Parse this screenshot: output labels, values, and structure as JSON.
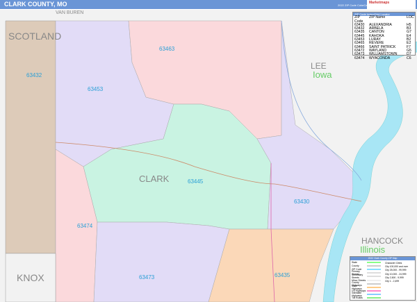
{
  "header": {
    "title": "CLARK COUNTY, MO",
    "edition": "2022 ZIP Code ColorCast Edition",
    "logo": "Marketmaps"
  },
  "map": {
    "neighbors": [
      {
        "name": "SCOTLAND"
      },
      {
        "name": "KNOX"
      },
      {
        "name": "VAN BUREN"
      },
      {
        "name": "LEE"
      },
      {
        "name": "HANCOCK"
      }
    ],
    "states": [
      {
        "name": "Iowa"
      },
      {
        "name": "Illinois"
      }
    ],
    "county": "CLARK",
    "zips": [
      "63463",
      "63453",
      "63432",
      "63445",
      "63430",
      "63474",
      "63473",
      "63435"
    ],
    "colors": {
      "pink": "#fbd9dc",
      "purple": "#e2dcf7",
      "green": "#c9f3e2",
      "orange": "#fbd8b8",
      "tan": "#ddcbb9",
      "river": "#a8e6f5",
      "gray": "#f2f2f2",
      "accent": "#6a95d6"
    }
  },
  "zip_table": {
    "title": "ZIP Code Index/Grid Locator",
    "headers": [
      "ZIP Code",
      "ZIP Name",
      "LOC"
    ],
    "rows": [
      [
        "63430",
        "ALEXANDRIA",
        "H5"
      ],
      [
        "63432",
        "ARBELA",
        "B3"
      ],
      [
        "63435",
        "CANTON",
        "G7"
      ],
      [
        "63445",
        "KAHOKA",
        "E4"
      ],
      [
        "63453",
        "LURAY",
        "B2"
      ],
      [
        "63465",
        "REVERE",
        "E2"
      ],
      [
        "63466",
        "SAINT PATRICK",
        "F7"
      ],
      [
        "63472",
        "WAYLAND",
        "G5"
      ],
      [
        "63473",
        "WILLIAMSTOWN",
        "D7"
      ],
      [
        "63474",
        "WYACONDA",
        "C6"
      ]
    ]
  },
  "legend": {
    "title": "2022 Clark County ZIP Map",
    "items": [
      "State",
      "County",
      "ZIP Code",
      "Primary Streets",
      "Secondary Streets",
      "Minor Streets",
      "County Highways",
      "State Highways",
      "US Highways",
      "Interstate Highways",
      "Toll Roads"
    ],
    "cities": [
      "Character Cities",
      "City 100,000 and over",
      "City 25,000 - 99,999",
      "City 10,000 - 24,999",
      "City 2,500 - 9,999",
      "City 1 - 2,499"
    ]
  }
}
